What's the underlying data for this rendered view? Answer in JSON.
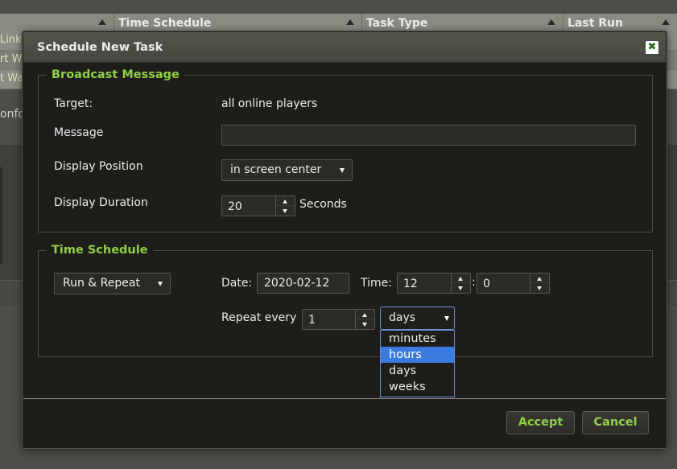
{
  "background": {
    "columns": [
      {
        "label": ""
      },
      {
        "label": "Time Schedule"
      },
      {
        "label": "Task Type"
      },
      {
        "label": "Last Run"
      }
    ],
    "rows": [
      "Link",
      "rt W",
      "t Wa"
    ],
    "conf_text": "onfo"
  },
  "dialog": {
    "title": "Schedule New Task",
    "close_icon": "✖",
    "broadcast": {
      "legend": "Broadcast Message",
      "target_label": "Target:",
      "target_value": "all online players",
      "message_label": "Message",
      "message_value": "",
      "position_label": "Display Position",
      "position_value": "in screen center",
      "duration_label": "Display Duration",
      "duration_value": "20",
      "duration_unit": "Seconds"
    },
    "schedule": {
      "legend": "Time Schedule",
      "mode_value": "Run & Repeat",
      "date_label": "Date:",
      "date_value": "2020-02-12",
      "time_label": "Time:",
      "hour_value": "12",
      "time_separator": ":",
      "minute_value": "0",
      "repeat_label": "Repeat every",
      "repeat_value": "1",
      "unit_value": "days",
      "unit_options": [
        "minutes",
        "hours",
        "days",
        "weeks"
      ],
      "highlighted_option": "hours"
    },
    "buttons": {
      "accept": "Accept",
      "cancel": "Cancel"
    }
  },
  "colors": {
    "accent_green": "#8fd04a",
    "dropdown_highlight": "#3d7ae0",
    "dialog_bg": "#1f1d1a"
  }
}
